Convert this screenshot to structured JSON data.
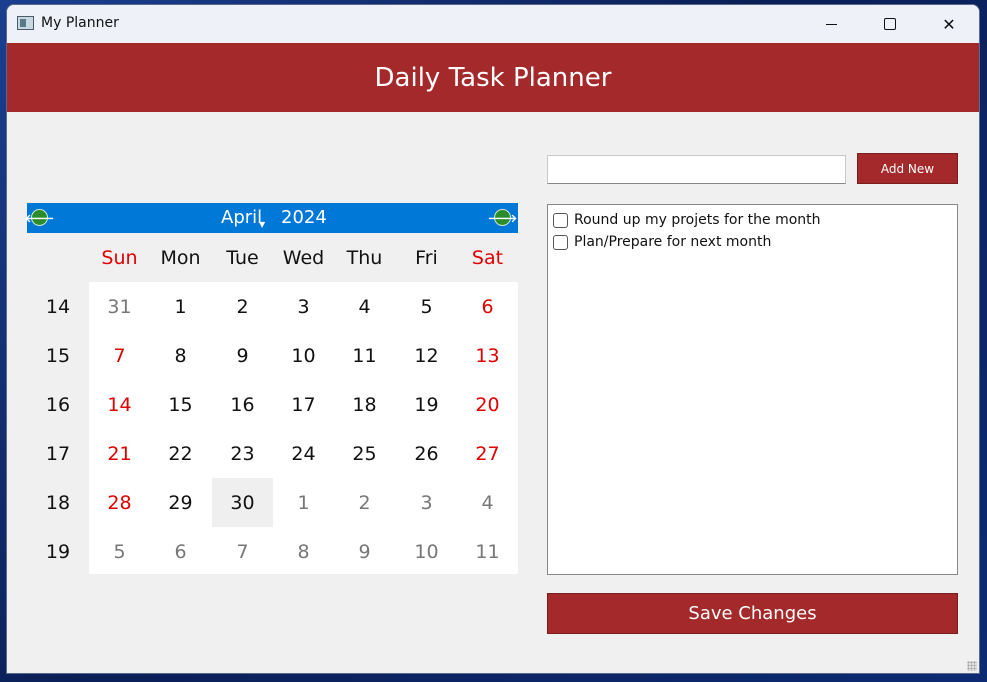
{
  "window": {
    "title": "My Planner",
    "minimize_glyph": "",
    "close_glyph": "✕"
  },
  "header": {
    "title": "Daily Task Planner"
  },
  "calendar": {
    "month": "April",
    "year": "2024",
    "prev_icon": "left-arrow-icon",
    "next_icon": "right-arrow-icon",
    "prev_glyph": "🡐",
    "next_glyph": "🡒",
    "weekdays": [
      "Sun",
      "Mon",
      "Tue",
      "Wed",
      "Thu",
      "Fri",
      "Sat"
    ],
    "week_numbers": [
      "14",
      "15",
      "16",
      "17",
      "18",
      "19"
    ],
    "weeks": [
      [
        "31",
        "1",
        "2",
        "3",
        "4",
        "5",
        "6"
      ],
      [
        "7",
        "8",
        "9",
        "10",
        "11",
        "12",
        "13"
      ],
      [
        "14",
        "15",
        "16",
        "17",
        "18",
        "19",
        "20"
      ],
      [
        "21",
        "22",
        "23",
        "24",
        "25",
        "26",
        "27"
      ],
      [
        "28",
        "29",
        "30",
        "1",
        "2",
        "3",
        "4"
      ],
      [
        "5",
        "6",
        "7",
        "8",
        "9",
        "10",
        "11"
      ]
    ],
    "selected_day": "30",
    "weekend_color": "#e00000",
    "nav_color": "#0078d7"
  },
  "tasks": {
    "input_value": "",
    "input_placeholder": "",
    "add_label": "Add New",
    "items": [
      {
        "label": "Round up my projets for the month",
        "checked": false
      },
      {
        "label": "Plan/Prepare for next month",
        "checked": false
      }
    ]
  },
  "save_label": "Save Changes",
  "colors": {
    "accent": "#a4292a",
    "background": "#f0f0f0"
  }
}
